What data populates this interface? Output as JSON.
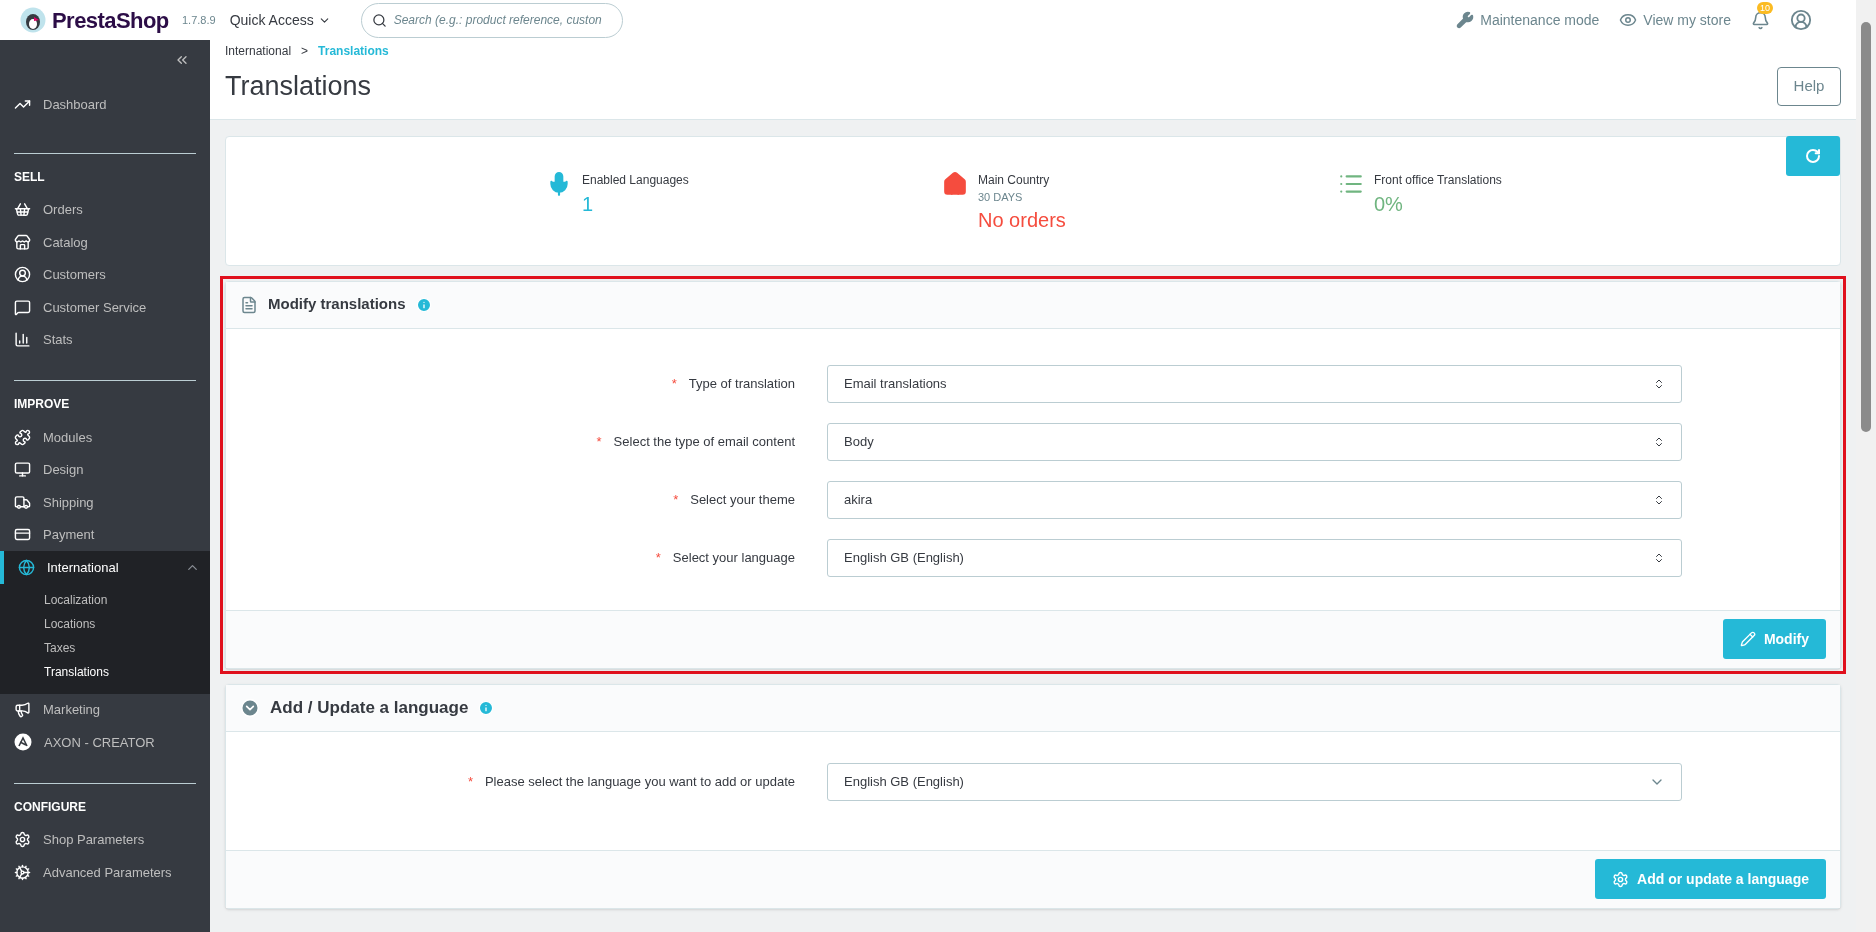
{
  "header": {
    "brand": "PrestaShop",
    "version": "1.7.8.9",
    "quick_access": "Quick Access",
    "search": {
      "placeholder": "Search (e.g.: product reference, custon"
    },
    "maintenance": "Maintenance mode",
    "view_store": "View my store",
    "notifications": "10"
  },
  "sidebar": {
    "top": [
      {
        "label": "Dashboard",
        "selected": false
      }
    ],
    "sections": [
      {
        "title": "SELL",
        "items": [
          {
            "label": "Orders",
            "selected": false
          },
          {
            "label": "Catalog",
            "selected": false
          },
          {
            "label": "Customers",
            "selected": false
          },
          {
            "label": "Customer Service",
            "selected": false
          },
          {
            "label": "Stats",
            "selected": false
          }
        ]
      },
      {
        "title": "IMPROVE",
        "items": [
          {
            "label": "Modules",
            "selected": false
          },
          {
            "label": "Design",
            "selected": false
          },
          {
            "label": "Shipping",
            "selected": false
          },
          {
            "label": "Payment",
            "selected": false
          },
          {
            "label": "International",
            "selected": true,
            "expanded": true,
            "children": [
              {
                "label": "Localization",
                "selected": false
              },
              {
                "label": "Locations",
                "selected": false
              },
              {
                "label": "Taxes",
                "selected": false
              },
              {
                "label": "Translations",
                "selected": true
              }
            ]
          },
          {
            "label": "Marketing",
            "selected": false
          },
          {
            "label": "AXON - CREATOR",
            "selected": false
          }
        ]
      },
      {
        "title": "CONFIGURE",
        "items": [
          {
            "label": "Shop Parameters",
            "selected": false
          },
          {
            "label": "Advanced Parameters",
            "selected": false
          }
        ]
      }
    ]
  },
  "breadcrumb_separator": ">",
  "breadcrumb": [
    {
      "label": "International",
      "selected": false
    },
    {
      "label": "Translations",
      "selected": true
    }
  ],
  "page_title": "Translations",
  "help_button": "Help",
  "kpis": [
    {
      "label": "Enabled Languages",
      "value": "1",
      "color": "#25b9d7"
    },
    {
      "label": "Main Country",
      "sub": "30 DAYS",
      "value": "No orders",
      "color": "#f54c3e"
    },
    {
      "label": "Front office Translations",
      "value": "0%",
      "color": "#70b580"
    }
  ],
  "panels": [
    {
      "title": "Modify translations",
      "highlighted": true,
      "fields": [
        {
          "label": "Type of translation",
          "required_mark": "*",
          "kind": "select",
          "value": "Email translations"
        },
        {
          "label": "Select the type of email content",
          "required_mark": "*",
          "kind": "select",
          "value": "Body"
        },
        {
          "label": "Select your theme",
          "required_mark": "*",
          "kind": "select",
          "value": "akira"
        },
        {
          "label": "Select your language",
          "required_mark": "*",
          "kind": "select",
          "value": "English GB (English)"
        }
      ],
      "button": "Modify"
    },
    {
      "title": "Add / Update a language",
      "highlighted": false,
      "fields": [
        {
          "label": "Please select the language you want to add or update",
          "required_mark": "*",
          "kind": "dropdown",
          "value": "English GB (English)"
        }
      ],
      "button": "Add or update a language"
    }
  ]
}
